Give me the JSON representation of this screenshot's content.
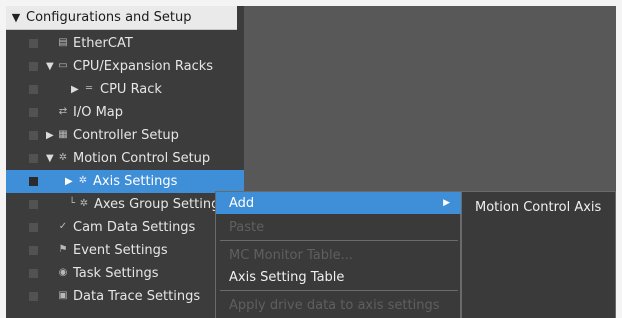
{
  "tree": {
    "header": "Configurations and Setup",
    "items": [
      {
        "label": "EtherCAT",
        "icon": "ethercat-icon"
      },
      {
        "label": "CPU/Expansion Racks",
        "icon": "cpu-racks-icon"
      },
      {
        "label": "CPU Rack",
        "icon": "cpu-rack-icon"
      },
      {
        "label": "I/O Map",
        "icon": "io-map-icon"
      },
      {
        "label": "Controller Setup",
        "icon": "controller-setup-icon"
      },
      {
        "label": "Motion Control Setup",
        "icon": "motion-control-icon"
      },
      {
        "label": "Axis Settings",
        "icon": "axis-settings-icon"
      },
      {
        "label": "Axes Group Settings",
        "icon": "axes-group-icon"
      },
      {
        "label": "Cam Data Settings",
        "icon": "cam-data-icon"
      },
      {
        "label": "Event Settings",
        "icon": "event-settings-icon"
      },
      {
        "label": "Task Settings",
        "icon": "task-settings-icon"
      },
      {
        "label": "Data Trace Settings",
        "icon": "data-trace-icon"
      }
    ]
  },
  "context_menu": {
    "items": [
      {
        "label": "Add",
        "state": "highlighted"
      },
      {
        "label": "Paste",
        "state": "disabled"
      },
      {
        "label": "MC Monitor Table...",
        "state": "disabled"
      },
      {
        "label": "Axis Setting Table",
        "state": "enabled"
      },
      {
        "label": "Apply drive data to axis settings",
        "state": "disabled"
      }
    ]
  },
  "submenu": {
    "items": [
      {
        "label": "Motion Control Axis"
      }
    ]
  },
  "colors": {
    "selection": "#3f8fd8",
    "panel_bg": "#3c3c3c",
    "workspace_bg": "#585858"
  }
}
